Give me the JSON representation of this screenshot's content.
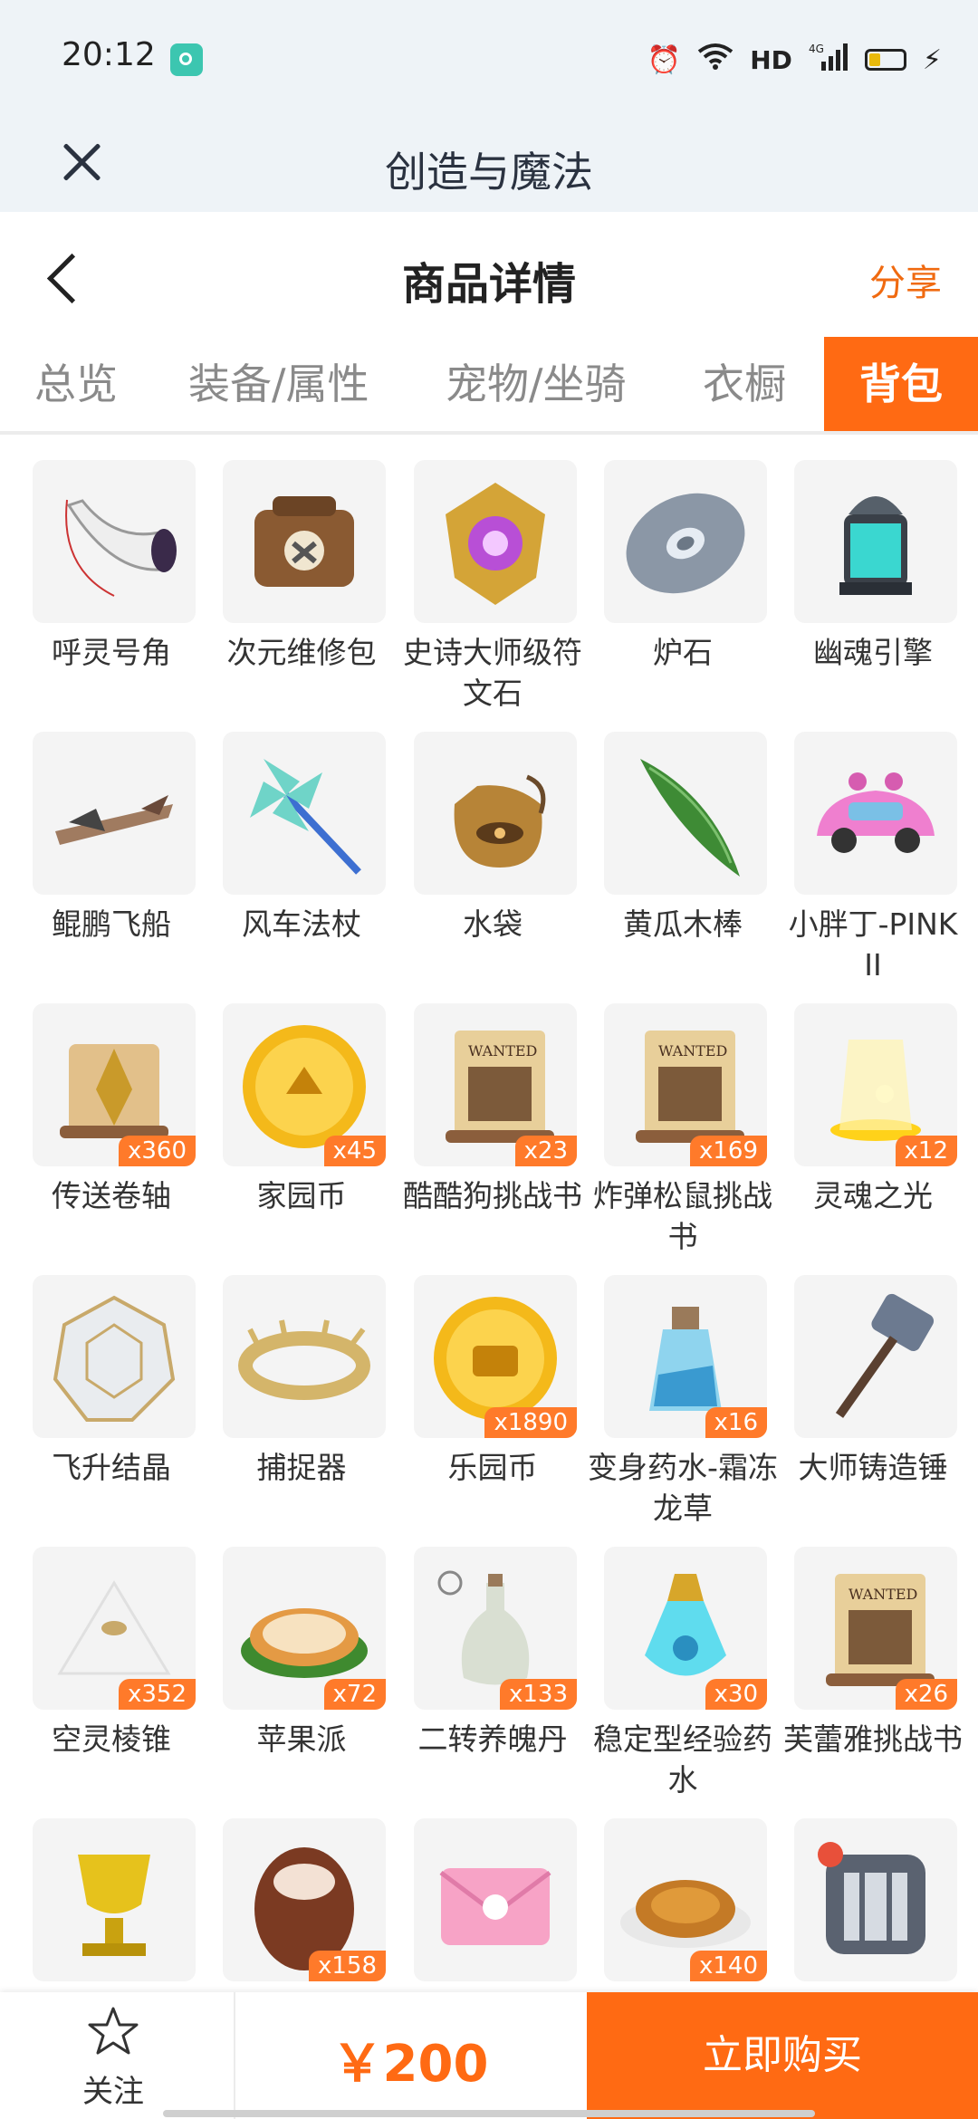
{
  "status": {
    "time": "20:12",
    "network": "HD",
    "signal": "4G"
  },
  "app": {
    "title": "创造与魔法"
  },
  "header": {
    "title": "商品详情",
    "share": "分享"
  },
  "tabs": [
    {
      "label": "总览",
      "active": false
    },
    {
      "label": "装备/属性",
      "active": false
    },
    {
      "label": "宠物/坐骑",
      "active": false
    },
    {
      "label": "衣橱",
      "active": false
    },
    {
      "label": "背包",
      "active": true
    }
  ],
  "items": [
    {
      "name": "呼灵号角",
      "qty": "",
      "icon": "horn-icon"
    },
    {
      "name": "次元维修包",
      "qty": "",
      "icon": "repair-bag-icon"
    },
    {
      "name": "史诗大师级符文石",
      "qty": "",
      "icon": "rune-stone-icon"
    },
    {
      "name": "炉石",
      "qty": "",
      "icon": "hearthstone-icon"
    },
    {
      "name": "幽魂引擎",
      "qty": "",
      "icon": "engine-icon"
    },
    {
      "name": "鲲鹏飞船",
      "qty": "",
      "icon": "airship-icon"
    },
    {
      "name": "风车法杖",
      "qty": "",
      "icon": "pinwheel-staff-icon"
    },
    {
      "name": "水袋",
      "qty": "",
      "icon": "water-bag-icon"
    },
    {
      "name": "黄瓜木棒",
      "qty": "",
      "icon": "cucumber-icon"
    },
    {
      "name": "小胖丁-PINK II",
      "qty": "",
      "icon": "pink-car-icon"
    },
    {
      "name": "传送卷轴",
      "qty": "x360",
      "icon": "teleport-scroll-icon"
    },
    {
      "name": "家园币",
      "qty": "x45",
      "icon": "home-coin-icon"
    },
    {
      "name": "酷酷狗挑战书",
      "qty": "x23",
      "icon": "wanted-scroll-icon"
    },
    {
      "name": "炸弹松鼠挑战书",
      "qty": "x169",
      "icon": "wanted-scroll-icon"
    },
    {
      "name": "灵魂之光",
      "qty": "x12",
      "icon": "soul-light-icon"
    },
    {
      "name": "飞升结晶",
      "qty": "",
      "icon": "crystal-icon"
    },
    {
      "name": "捕捉器",
      "qty": "",
      "icon": "catcher-icon"
    },
    {
      "name": "乐园币",
      "qty": "x1890",
      "icon": "park-coin-icon"
    },
    {
      "name": "变身药水-霜冻龙草",
      "qty": "x16",
      "icon": "potion-icon"
    },
    {
      "name": "大师铸造锤",
      "qty": "",
      "icon": "hammer-icon"
    },
    {
      "name": "空灵棱锥",
      "qty": "x352",
      "icon": "pyramid-icon"
    },
    {
      "name": "苹果派",
      "qty": "x72",
      "icon": "apple-pie-icon"
    },
    {
      "name": "二转养魄丹",
      "qty": "x133",
      "icon": "bottle-icon"
    },
    {
      "name": "稳定型经验药水",
      "qty": "x30",
      "icon": "exp-potion-icon"
    },
    {
      "name": "芙蕾雅挑战书",
      "qty": "x26",
      "icon": "wanted-scroll-icon"
    },
    {
      "name": "",
      "qty": "",
      "icon": "trophy-icon"
    },
    {
      "name": "",
      "qty": "x158",
      "icon": "egg-icon"
    },
    {
      "name": "",
      "qty": "",
      "icon": "envelope-icon"
    },
    {
      "name": "",
      "qty": "x140",
      "icon": "mooncake-icon"
    },
    {
      "name": "",
      "qty": "",
      "icon": "pet-cage-icon"
    }
  ],
  "bottom": {
    "follow": "关注",
    "price": "￥200",
    "buy": "立即购买"
  }
}
